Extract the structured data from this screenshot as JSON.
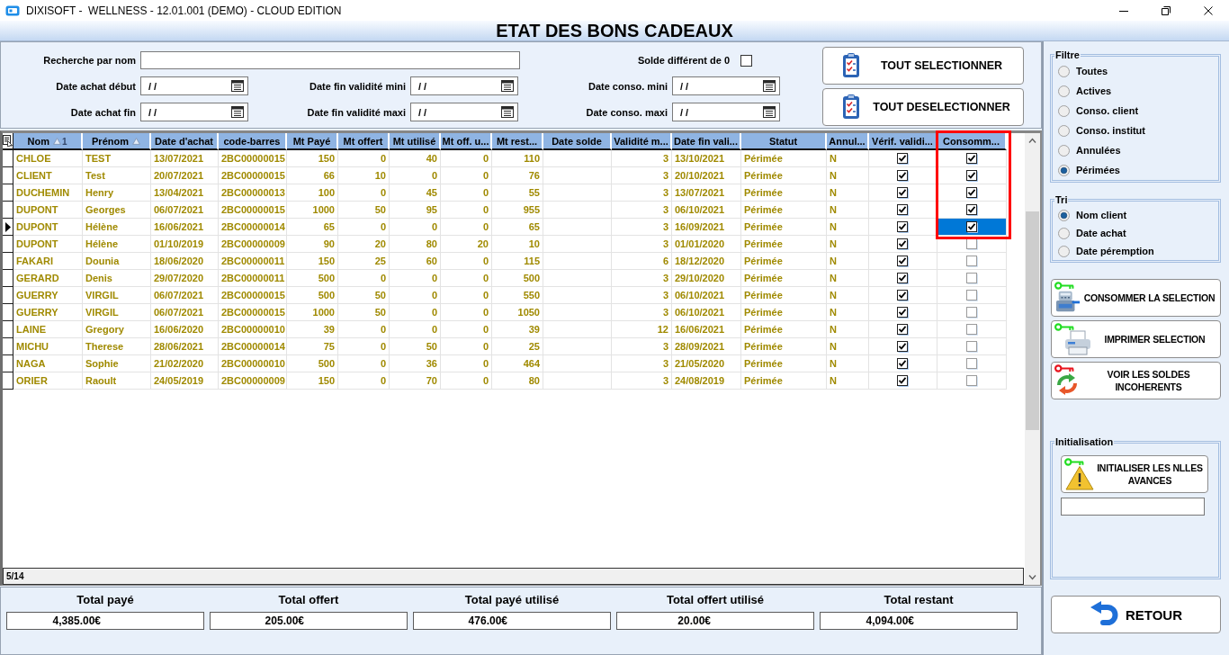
{
  "window": {
    "title": "DIXISOFT -  WELLNESS - 12.01.001 (DEMO) - CLOUD EDITION"
  },
  "heading": "ETAT DES BONS CADEAUX",
  "criteria": {
    "name_search": {
      "label": "Recherche par nom"
    },
    "nonzero_balance": {
      "label": "Solde différent de 0",
      "checked": false
    },
    "date_fields": [
      {
        "label": "Date achat début",
        "value": "/ /"
      },
      {
        "label": "Date fin validité mini",
        "value": "/ /"
      },
      {
        "label": "Date conso. mini",
        "value": "/ /"
      },
      {
        "label": "Date achat fin",
        "value": "/ /"
      },
      {
        "label": "Date fin validité maxi",
        "value": "/ /"
      },
      {
        "label": "Date conso. maxi",
        "value": "/ /"
      }
    ]
  },
  "selection_buttons": [
    "TOUT SELECTIONNER",
    "TOUT DESELECTIONNER"
  ],
  "table": {
    "columns": [
      {
        "label": "Nom",
        "kind": "text",
        "sorted": true,
        "sort_rank": "1",
        "highlighted": false
      },
      {
        "label": "Prénom",
        "kind": "text",
        "sorted": true,
        "highlighted": false
      },
      {
        "label": "Date d'achat",
        "kind": "text",
        "sorted": false,
        "highlighted": false
      },
      {
        "label": "code-barres",
        "kind": "text",
        "sorted": false,
        "highlighted": false
      },
      {
        "label": "Mt Payé",
        "kind": "number",
        "sorted": false,
        "highlighted": false
      },
      {
        "label": "Mt offert",
        "kind": "number",
        "sorted": false,
        "highlighted": false
      },
      {
        "label": "Mt utilisé",
        "kind": "number",
        "sorted": false,
        "highlighted": false
      },
      {
        "label": "Mt off. u...",
        "kind": "number",
        "sorted": false,
        "highlighted": false
      },
      {
        "label": "Mt rest...",
        "kind": "number",
        "sorted": false,
        "highlighted": false
      },
      {
        "label": "Date solde",
        "kind": "text",
        "sorted": false,
        "highlighted": false
      },
      {
        "label": "Validité m...",
        "kind": "number",
        "sorted": false,
        "highlighted": false
      },
      {
        "label": "Date fin vali...",
        "kind": "text",
        "sorted": false,
        "highlighted": false
      },
      {
        "label": "Statut",
        "kind": "text",
        "sorted": false,
        "highlighted": false
      },
      {
        "label": "Annul...",
        "kind": "text",
        "sorted": false,
        "highlighted": false
      },
      {
        "label": "Vérif. validi...",
        "kind": "check",
        "sorted": false,
        "highlighted": false
      },
      {
        "label": "Consomm...",
        "kind": "check",
        "sorted": false,
        "highlighted": true
      }
    ],
    "rows": [
      {
        "cells": [
          "CHLOE",
          "TEST",
          "13/07/2021",
          "2BC00000015",
          "150",
          "0",
          "40",
          "0",
          "110",
          "",
          "3",
          "13/10/2021",
          "Périmée",
          "N"
        ],
        "checks": [
          {
            "checked": true,
            "focused": false
          },
          {
            "checked": true,
            "focused": false
          }
        ],
        "selected": false
      },
      {
        "cells": [
          "CLIENT",
          "Test",
          "20/07/2021",
          "2BC00000015",
          "66",
          "10",
          "0",
          "0",
          "76",
          "",
          "3",
          "20/10/2021",
          "Périmée",
          "N"
        ],
        "checks": [
          {
            "checked": true,
            "focused": false
          },
          {
            "checked": true,
            "focused": false
          }
        ],
        "selected": false
      },
      {
        "cells": [
          "DUCHEMIN",
          "Henry",
          "13/04/2021",
          "2BC00000013",
          "100",
          "0",
          "45",
          "0",
          "55",
          "",
          "3",
          "13/07/2021",
          "Périmée",
          "N"
        ],
        "checks": [
          {
            "checked": true,
            "focused": false
          },
          {
            "checked": true,
            "focused": false
          }
        ],
        "selected": false
      },
      {
        "cells": [
          "DUPONT",
          "Georges",
          "06/07/2021",
          "2BC00000015",
          "1000",
          "50",
          "95",
          "0",
          "955",
          "",
          "3",
          "06/10/2021",
          "Périmée",
          "N"
        ],
        "checks": [
          {
            "checked": true,
            "focused": false
          },
          {
            "checked": true,
            "focused": false
          }
        ],
        "selected": false
      },
      {
        "cells": [
          "DUPONT",
          "Hélène",
          "16/06/2021",
          "2BC00000014",
          "65",
          "0",
          "0",
          "0",
          "65",
          "",
          "3",
          "16/09/2021",
          "Périmée",
          "N"
        ],
        "checks": [
          {
            "checked": true,
            "focused": false
          },
          {
            "checked": true,
            "focused": true
          }
        ],
        "selected": true
      },
      {
        "cells": [
          "DUPONT",
          "Hélène",
          "01/10/2019",
          "2BC00000009",
          "90",
          "20",
          "80",
          "20",
          "10",
          "",
          "3",
          "01/01/2020",
          "Périmée",
          "N"
        ],
        "checks": [
          {
            "checked": true,
            "focused": false
          },
          {
            "checked": false,
            "focused": false
          }
        ],
        "selected": false
      },
      {
        "cells": [
          "FAKARI",
          "Dounia",
          "18/06/2020",
          "2BC00000011",
          "150",
          "25",
          "60",
          "0",
          "115",
          "",
          "6",
          "18/12/2020",
          "Périmée",
          "N"
        ],
        "checks": [
          {
            "checked": true,
            "focused": false
          },
          {
            "checked": false,
            "focused": false
          }
        ],
        "selected": false
      },
      {
        "cells": [
          "GERARD",
          "Denis",
          "29/07/2020",
          "2BC00000011",
          "500",
          "0",
          "0",
          "0",
          "500",
          "",
          "3",
          "29/10/2020",
          "Périmée",
          "N"
        ],
        "checks": [
          {
            "checked": true,
            "focused": false
          },
          {
            "checked": false,
            "focused": false
          }
        ],
        "selected": false
      },
      {
        "cells": [
          "GUERRY",
          "VIRGIL",
          "06/07/2021",
          "2BC00000015",
          "500",
          "50",
          "0",
          "0",
          "550",
          "",
          "3",
          "06/10/2021",
          "Périmée",
          "N"
        ],
        "checks": [
          {
            "checked": true,
            "focused": false
          },
          {
            "checked": false,
            "focused": false
          }
        ],
        "selected": false
      },
      {
        "cells": [
          "GUERRY",
          "VIRGIL",
          "06/07/2021",
          "2BC00000015",
          "1000",
          "50",
          "0",
          "0",
          "1050",
          "",
          "3",
          "06/10/2021",
          "Périmée",
          "N"
        ],
        "checks": [
          {
            "checked": true,
            "focused": false
          },
          {
            "checked": false,
            "focused": false
          }
        ],
        "selected": false
      },
      {
        "cells": [
          "LAINE",
          "Gregory",
          "16/06/2020",
          "2BC00000010",
          "39",
          "0",
          "0",
          "0",
          "39",
          "",
          "12",
          "16/06/2021",
          "Périmée",
          "N"
        ],
        "checks": [
          {
            "checked": true,
            "focused": false
          },
          {
            "checked": false,
            "focused": false
          }
        ],
        "selected": false
      },
      {
        "cells": [
          "MICHU",
          "Therese",
          "28/06/2021",
          "2BC00000014",
          "75",
          "0",
          "50",
          "0",
          "25",
          "",
          "3",
          "28/09/2021",
          "Périmée",
          "N"
        ],
        "checks": [
          {
            "checked": true,
            "focused": false
          },
          {
            "checked": false,
            "focused": false
          }
        ],
        "selected": false
      },
      {
        "cells": [
          "NAGA",
          "Sophie",
          "21/02/2020",
          "2BC00000010",
          "500",
          "0",
          "36",
          "0",
          "464",
          "",
          "3",
          "21/05/2020",
          "Périmée",
          "N"
        ],
        "checks": [
          {
            "checked": true,
            "focused": false
          },
          {
            "checked": false,
            "focused": false
          }
        ],
        "selected": false
      },
      {
        "cells": [
          "ORIER",
          "Raoult",
          "24/05/2019",
          "2BC00000009",
          "150",
          "0",
          "70",
          "0",
          "80",
          "",
          "3",
          "24/08/2019",
          "Périmée",
          "N"
        ],
        "checks": [
          {
            "checked": true,
            "focused": false
          },
          {
            "checked": false,
            "focused": false
          }
        ],
        "selected": false
      }
    ],
    "status": "5/14"
  },
  "totals": [
    {
      "label": "Total payé",
      "value": "4,385.00€"
    },
    {
      "label": "Total offert",
      "value": "205.00€"
    },
    {
      "label": "Total payé utilisé",
      "value": "476.00€"
    },
    {
      "label": "Total offert utilisé",
      "value": "20.00€"
    },
    {
      "label": "Total restant",
      "value": "4,094.00€"
    }
  ],
  "filter": {
    "title": "Filtre",
    "options": [
      {
        "label": "Toutes",
        "selected": false
      },
      {
        "label": "Actives",
        "selected": false
      },
      {
        "label": "Conso. client",
        "selected": false
      },
      {
        "label": "Conso. institut",
        "selected": false
      },
      {
        "label": "Annulées",
        "selected": false
      },
      {
        "label": "Périmées",
        "selected": true
      }
    ]
  },
  "sort": {
    "title": "Tri",
    "options": [
      {
        "label": "Nom client",
        "selected": true
      },
      {
        "label": "Date achat",
        "selected": false
      },
      {
        "label": "Date péremption",
        "selected": false
      }
    ]
  },
  "actions": [
    {
      "label": "CONSOMMER LA SELECTION",
      "kind": "consume",
      "color": "#22dd22"
    },
    {
      "label": "IMPRIMER SELECTION",
      "kind": "print",
      "color": "#22dd22"
    },
    {
      "label": "VOIR LES SOLDES INCOHERENTS",
      "kind": "check",
      "color": "#e8141e"
    }
  ],
  "initialisation": {
    "title": "Initialisation",
    "button": "INITIALISER LES NLLES AVANCES",
    "color": "#22dd22"
  },
  "back_button": "RETOUR"
}
